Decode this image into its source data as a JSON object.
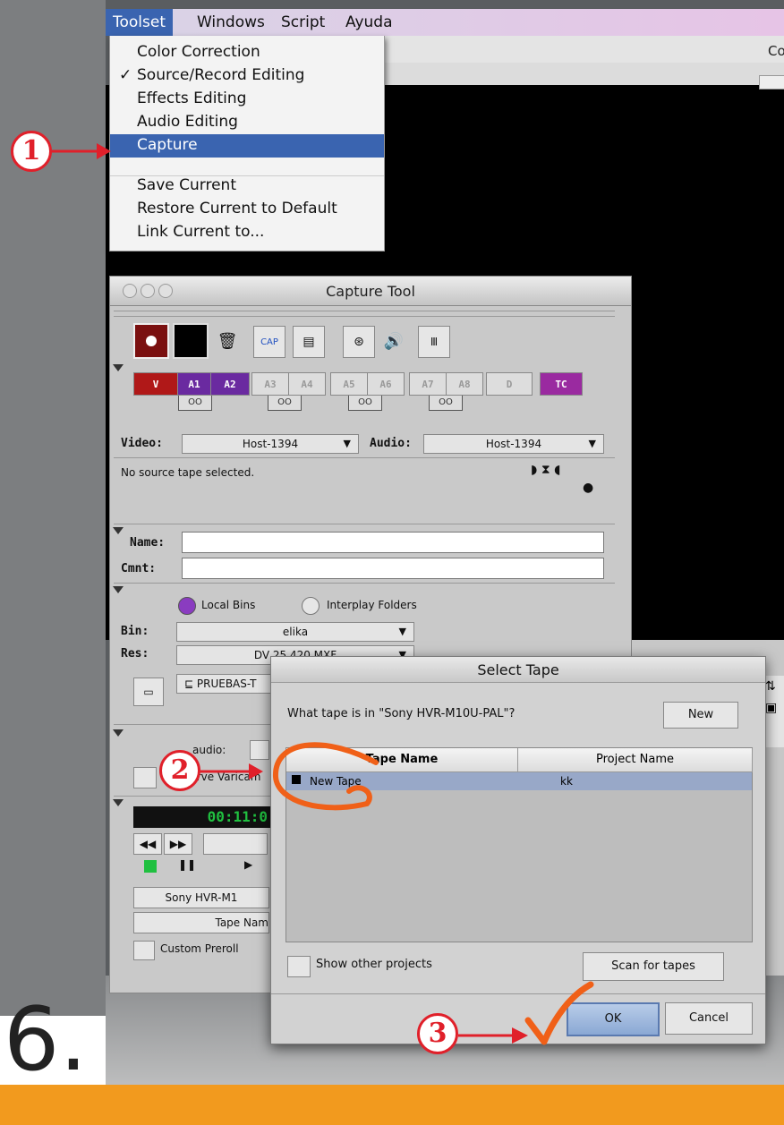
{
  "menubar": {
    "items": [
      {
        "label": "Toolset",
        "active": true
      },
      {
        "label": "Windows"
      },
      {
        "label": "Script"
      },
      {
        "label": "Ayuda"
      }
    ],
    "window_title_fragment": "Co"
  },
  "toolset_menu": {
    "items": [
      {
        "label": "Color Correction",
        "checked": false
      },
      {
        "label": "Source/Record Editing",
        "checked": true
      },
      {
        "label": "Effects Editing",
        "checked": false
      },
      {
        "label": "Audio Editing",
        "checked": false
      },
      {
        "label": "Capture",
        "selected": true
      },
      {
        "label": "Save Current"
      },
      {
        "label": "Restore Current to Default"
      },
      {
        "label": "Link Current to..."
      }
    ],
    "check_glyph": "✓"
  },
  "capture_tool": {
    "title": "Capture Tool",
    "tracks": [
      "V",
      "A1",
      "A2",
      "A3",
      "A4",
      "A5",
      "A6",
      "A7",
      "A8",
      "D",
      "TC"
    ],
    "link_glyph": "OO",
    "video_label": "Video:",
    "video_value": "Host-1394",
    "audio_label": "Audio:",
    "audio_value": "Host-1394",
    "status_text": "No source tape selected.",
    "name_label": "Name:",
    "cmnt_label": "Cmnt:",
    "local_bins": "Local Bins",
    "interplay_folders": "Interplay Folders",
    "bin_label": "Bin:",
    "bin_value": "elika",
    "res_label": "Res:",
    "res_value": "DV 25 420 MXF",
    "target_drive": "PRUEBAS-T",
    "audio_frag": "audio:",
    "preserve_frag": "Preserve Varicam",
    "timecode": "00:11:0",
    "deck": "Sony HVR-M1",
    "tape_name_btn": "Tape Nam",
    "custom_preroll": "Custom Preroll"
  },
  "select_tape": {
    "title": "Select Tape",
    "question": "What tape is in \"Sony HVR-M10U-PAL\"?",
    "new_button": "New",
    "col_tape_name": "Tape Name",
    "col_project_name": "Project Name",
    "row_tape": "New Tape",
    "row_project": "kk",
    "show_other_projects": "Show other projects",
    "scan_button": "Scan for tapes",
    "ok_button": "OK",
    "cancel_button": "Cancel"
  },
  "annotations": {
    "step1": "1",
    "step2": "2",
    "step3": "3",
    "big_step": "6."
  },
  "colors": {
    "menu_highlight": "#3a64b0",
    "annotation_red": "#e0202a",
    "annotation_orange": "#f06018",
    "bottom_bar": "#f29a1e",
    "track_v": "#b01818",
    "track_a": "#6a2aa0",
    "track_tc": "#9a2aa0",
    "timecode_green": "#20c040"
  }
}
